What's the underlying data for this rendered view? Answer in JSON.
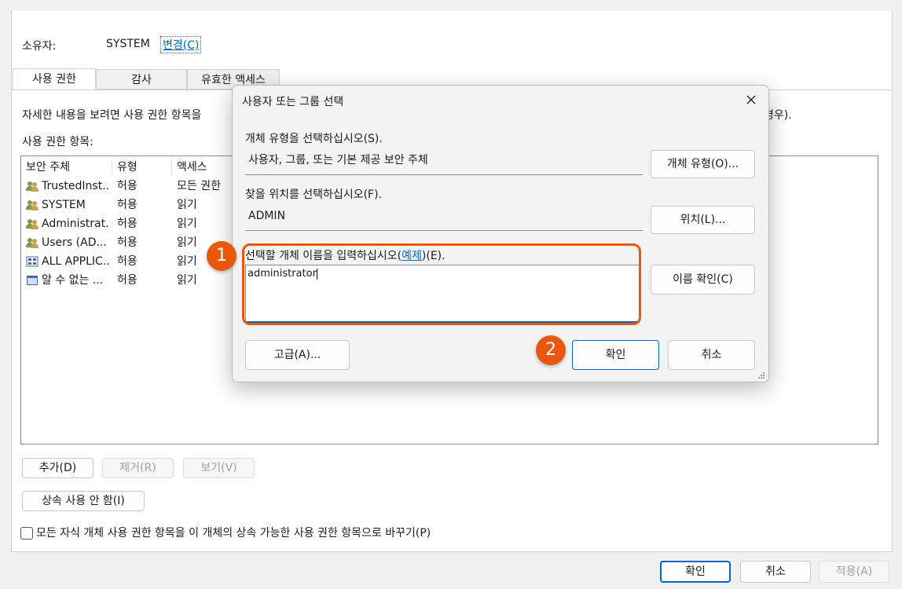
{
  "owner": {
    "label": "소유자:",
    "value": "SYSTEM",
    "change_link": "변경(C)"
  },
  "tabs": [
    "사용 권한",
    "감사",
    "유효한 액세스"
  ],
  "info_text": "자세한 내용을 보려면 사용 권한 항목을",
  "info_tail": "경우).",
  "entries_label": "사용 권한 항목:",
  "columns": [
    "보안 주체",
    "유형",
    "액세스"
  ],
  "rows": [
    {
      "principal": "TrustedInst...",
      "type": "허용",
      "access": "모든 권한",
      "icon": "user-group-icon"
    },
    {
      "principal": "SYSTEM",
      "type": "허용",
      "access": "읽기",
      "icon": "user-group-icon"
    },
    {
      "principal": "Administrat...",
      "type": "허용",
      "access": "읽기",
      "icon": "user-group-icon"
    },
    {
      "principal": "Users (AD...",
      "type": "허용",
      "access": "읽기",
      "icon": "user-group-icon"
    },
    {
      "principal": "ALL APPLIC...",
      "type": "허용",
      "access": "읽기",
      "icon": "app-package-icon"
    },
    {
      "principal": "알 수 없는 ...",
      "type": "허용",
      "access": "읽기",
      "icon": "unknown-account-icon"
    }
  ],
  "list_buttons": {
    "add": "추가(D)",
    "remove": "제거(R)",
    "view": "보기(V)"
  },
  "disable_inheritance": "상속 사용 안 함(I)",
  "replace_checkbox_label": "모든 자식 개체 사용 권한 항목을 이 개체의 상속 가능한 사용 권한 항목으로 바꾸기(P)",
  "footer": {
    "ok": "확인",
    "cancel": "취소",
    "apply": "적용(A)"
  },
  "dialog": {
    "title": "사용자 또는 그룹 선택",
    "object_type_label": "개체 유형을 선택하십시오(S).",
    "object_type_value": "사용자, 그룹, 또는 기본 제공 보안 주체",
    "object_type_button": "개체 유형(O)...",
    "location_label": "찾을 위치를 선택하십시오(F).",
    "location_value": "ADMIN",
    "location_button": "위치(L)...",
    "name_label_pre": "선택할 개체 이름을 입력하십시오(",
    "name_label_link": "예제",
    "name_label_post": ")(E).",
    "name_value": "administrator",
    "check_names_button": "이름 확인(C)",
    "advanced_button": "고급(A)...",
    "ok_button": "확인",
    "cancel_button": "취소"
  },
  "annotations": {
    "step1": "1",
    "step2": "2"
  },
  "colors": {
    "accent": "#0067c0",
    "highlight": "#e8580c"
  }
}
